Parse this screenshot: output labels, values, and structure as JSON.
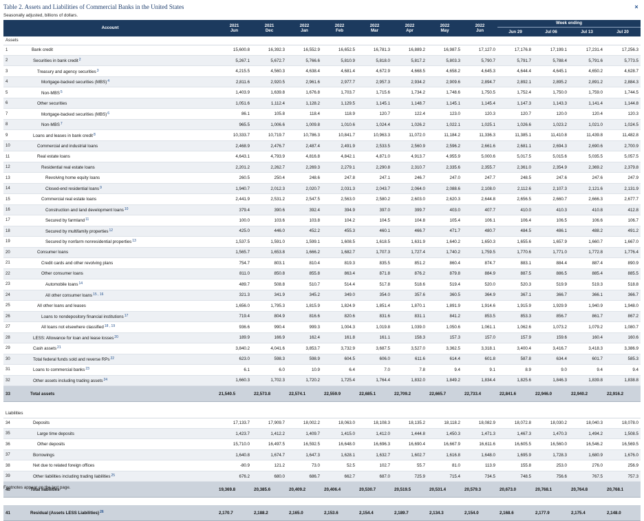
{
  "title": "Table 2. Assets and Liabilities of Commercial Banks in the United States",
  "subtitle": "Seasonally adjusted, billions of dollars.",
  "close_icon": "×",
  "footnote": "Footnotes appear on the last page.",
  "header": {
    "account": "Account",
    "week_ending": "Week ending",
    "columns": [
      {
        "top": "2021",
        "bottom": "Jun"
      },
      {
        "top": "2021",
        "bottom": "Dec"
      },
      {
        "top": "2022",
        "bottom": "Jan"
      },
      {
        "top": "2022",
        "bottom": "Feb"
      },
      {
        "top": "2022",
        "bottom": "Mar"
      },
      {
        "top": "2022",
        "bottom": "Apr"
      },
      {
        "top": "2022",
        "bottom": "May"
      },
      {
        "top": "2022",
        "bottom": "Jun"
      }
    ],
    "weeks": [
      "Jun 29",
      "Jul 06",
      "Jul 13",
      "Jul 20"
    ]
  },
  "sections": [
    {
      "label": "Assets",
      "rows": [
        {
          "n": "1",
          "label": "Bank credit",
          "indent": 0,
          "values": [
            "15,600.8",
            "16,392.3",
            "16,552.9",
            "16,652.5",
            "16,781.3",
            "16,889.2",
            "16,987.5",
            "17,127.0",
            "17,176.8",
            "17,199.1",
            "17,231.4",
            "17,256.3"
          ]
        },
        {
          "n": "2",
          "label": "Securities in bank credit",
          "fn": "2",
          "indent": 1,
          "values": [
            "5,267.1",
            "5,672.7",
            "5,766.6",
            "5,810.9",
            "5,818.0",
            "5,817.2",
            "5,803.3",
            "5,790.7",
            "5,791.7",
            "5,788.4",
            "5,791.6",
            "5,773.5"
          ]
        },
        {
          "n": "3",
          "label": "Treasury and agency securities",
          "fn": "3",
          "indent": 2,
          "values": [
            "4,215.5",
            "4,560.3",
            "4,638.4",
            "4,681.4",
            "4,672.9",
            "4,668.5",
            "4,658.2",
            "4,645.3",
            "4,644.4",
            "4,645.1",
            "4,650.2",
            "4,628.7"
          ]
        },
        {
          "n": "4",
          "label": "Mortgage-backed securities (MBS)",
          "fn": "4",
          "indent": 3,
          "values": [
            "2,811.6",
            "2,920.5",
            "2,961.6",
            "2,977.7",
            "2,957.3",
            "2,934.2",
            "2,909.6",
            "2,894.7",
            "2,892.1",
            "2,895.2",
            "2,891.2",
            "2,884.3"
          ]
        },
        {
          "n": "5",
          "label": "Non-MBS",
          "fn": "5",
          "indent": 3,
          "values": [
            "1,403.9",
            "1,639.8",
            "1,676.8",
            "1,703.7",
            "1,715.6",
            "1,734.2",
            "1,748.6",
            "1,750.5",
            "1,752.4",
            "1,750.0",
            "1,759.0",
            "1,744.5"
          ]
        },
        {
          "n": "6",
          "label": "Other securities",
          "indent": 2,
          "values": [
            "1,051.6",
            "1,112.4",
            "1,128.2",
            "1,129.5",
            "1,145.1",
            "1,148.7",
            "1,145.1",
            "1,145.4",
            "1,147.3",
            "1,143.3",
            "1,141.4",
            "1,144.8"
          ]
        },
        {
          "n": "7",
          "label": "Mortgage-backed securities (MBS)",
          "fn": "6",
          "indent": 3,
          "values": [
            "86.1",
            "105.8",
            "118.4",
            "118.9",
            "120.7",
            "122.4",
            "123.0",
            "120.3",
            "120.7",
            "120.0",
            "120.4",
            "120.3"
          ]
        },
        {
          "n": "8",
          "label": "Non-MBS",
          "fn": "7",
          "indent": 3,
          "values": [
            "965.5",
            "1,006.6",
            "1,009.8",
            "1,010.6",
            "1,024.4",
            "1,026.2",
            "1,022.1",
            "1,025.1",
            "1,026.6",
            "1,023.2",
            "1,021.0",
            "1,024.5"
          ]
        },
        {
          "n": "9",
          "label": "Loans and leases in bank credit",
          "fn": "8",
          "indent": 1,
          "values": [
            "10,333.7",
            "10,719.7",
            "10,786.3",
            "10,841.7",
            "10,963.3",
            "11,072.0",
            "11,184.2",
            "11,336.3",
            "11,385.1",
            "11,410.8",
            "11,439.8",
            "11,482.8"
          ]
        },
        {
          "n": "10",
          "label": "Commercial and industrial loans",
          "indent": 2,
          "values": [
            "2,468.9",
            "2,476.7",
            "2,487.4",
            "2,491.9",
            "2,533.5",
            "2,560.9",
            "2,596.2",
            "2,661.6",
            "2,681.1",
            "2,694.3",
            "2,690.6",
            "2,700.9"
          ]
        },
        {
          "n": "11",
          "label": "Real estate loans",
          "indent": 2,
          "values": [
            "4,643.1",
            "4,793.9",
            "4,816.8",
            "4,842.1",
            "4,871.0",
            "4,913.7",
            "4,955.9",
            "5,000.6",
            "5,017.5",
            "5,015.6",
            "5,035.5",
            "5,057.5"
          ]
        },
        {
          "n": "12",
          "label": "Residential real estate loans",
          "indent": 3,
          "values": [
            "2,201.2",
            "2,262.7",
            "2,269.3",
            "2,279.1",
            "2,290.8",
            "2,310.7",
            "2,335.6",
            "2,355.7",
            "2,361.0",
            "2,354.9",
            "2,369.2",
            "2,379.8"
          ]
        },
        {
          "n": "13",
          "label": "Revolving home equity loans",
          "indent": 4,
          "values": [
            "260.5",
            "250.4",
            "248.6",
            "247.8",
            "247.1",
            "246.7",
            "247.0",
            "247.7",
            "248.5",
            "247.6",
            "247.6",
            "247.9"
          ]
        },
        {
          "n": "14",
          "label": "Closed-end residential loans",
          "fn": "9",
          "indent": 4,
          "values": [
            "1,940.7",
            "2,012.3",
            "2,020.7",
            "2,031.3",
            "2,043.7",
            "2,064.0",
            "2,088.6",
            "2,108.0",
            "2,112.6",
            "2,107.3",
            "2,121.6",
            "2,131.9"
          ]
        },
        {
          "n": "15",
          "label": "Commercial real estate loans",
          "indent": 3,
          "values": [
            "2,441.9",
            "2,531.2",
            "2,547.5",
            "2,563.0",
            "2,580.2",
            "2,603.0",
            "2,620.3",
            "2,644.8",
            "2,656.5",
            "2,660.7",
            "2,666.3",
            "2,677.7"
          ]
        },
        {
          "n": "16",
          "label": "Construction and land development loans",
          "fn": "10",
          "indent": 4,
          "values": [
            "379.4",
            "390.6",
            "392.4",
            "394.9",
            "397.0",
            "399.7",
            "403.0",
            "407.7",
            "410.0",
            "410.3",
            "410.8",
            "412.8"
          ]
        },
        {
          "n": "17",
          "label": "Secured by farmland",
          "fn": "11",
          "indent": 4,
          "values": [
            "100.0",
            "103.6",
            "103.8",
            "104.2",
            "104.5",
            "104.8",
            "105.4",
            "106.1",
            "106.4",
            "106.5",
            "106.6",
            "106.7"
          ]
        },
        {
          "n": "18",
          "label": "Secured by multifamily properties",
          "fn": "12",
          "indent": 4,
          "values": [
            "425.0",
            "446.0",
            "452.2",
            "455.3",
            "460.1",
            "466.7",
            "471.7",
            "480.7",
            "484.5",
            "486.1",
            "488.2",
            "491.2"
          ]
        },
        {
          "n": "19",
          "label": "Secured by nonfarm nonresidential properties",
          "fn": "13",
          "indent": 4,
          "values": [
            "1,537.5",
            "1,591.0",
            "1,599.1",
            "1,608.5",
            "1,618.5",
            "1,631.9",
            "1,640.2",
            "1,650.3",
            "1,655.6",
            "1,657.9",
            "1,660.7",
            "1,667.0"
          ]
        },
        {
          "n": "20",
          "label": "Consumer loans",
          "indent": 2,
          "values": [
            "1,565.7",
            "1,653.8",
            "1,666.2",
            "1,682.7",
            "1,707.3",
            "1,727.4",
            "1,740.2",
            "1,759.5",
            "1,770.6",
            "1,771.0",
            "1,772.8",
            "1,776.4"
          ]
        },
        {
          "n": "21",
          "label": "Credit cards and other revolving plans",
          "indent": 3,
          "values": [
            "754.7",
            "803.1",
            "810.4",
            "819.3",
            "835.5",
            "851.2",
            "860.4",
            "874.7",
            "883.1",
            "884.4",
            "887.4",
            "890.9"
          ]
        },
        {
          "n": "22",
          "label": "Other consumer loans",
          "indent": 3,
          "values": [
            "811.0",
            "850.8",
            "855.8",
            "863.4",
            "871.8",
            "876.2",
            "879.8",
            "884.9",
            "887.5",
            "886.5",
            "885.4",
            "885.5"
          ]
        },
        {
          "n": "23",
          "label": "Automobile loans",
          "fn": "14",
          "indent": 4,
          "values": [
            "489.7",
            "508.8",
            "510.7",
            "514.4",
            "517.8",
            "518.6",
            "519.4",
            "520.0",
            "520.3",
            "519.9",
            "519.3",
            "518.8"
          ]
        },
        {
          "n": "24",
          "label": "All other consumer loans",
          "fn": "15 , 16",
          "indent": 4,
          "values": [
            "321.3",
            "341.9",
            "345.2",
            "349.0",
            "354.0",
            "357.6",
            "360.5",
            "364.9",
            "367.1",
            "366.7",
            "366.1",
            "366.7"
          ]
        },
        {
          "n": "25",
          "label": "All other loans and leases",
          "indent": 2,
          "values": [
            "1,656.0",
            "1,795.3",
            "1,815.9",
            "1,824.9",
            "1,851.4",
            "1,870.1",
            "1,891.9",
            "1,914.6",
            "1,915.9",
            "1,929.9",
            "1,940.9",
            "1,948.0"
          ]
        },
        {
          "n": "26",
          "label": "Loans to nondepository financial institutions",
          "fn": "17",
          "indent": 3,
          "values": [
            "719.4",
            "804.9",
            "816.6",
            "820.6",
            "831.6",
            "831.1",
            "841.2",
            "853.5",
            "853.3",
            "856.7",
            "861.7",
            "867.2"
          ]
        },
        {
          "n": "27",
          "label": "All loans not elsewhere classified",
          "fn": "18 , 19",
          "indent": 3,
          "values": [
            "936.6",
            "990.4",
            "999.3",
            "1,004.3",
            "1,019.8",
            "1,039.0",
            "1,050.6",
            "1,061.1",
            "1,062.6",
            "1,073.2",
            "1,079.2",
            "1,080.7"
          ]
        },
        {
          "n": "28",
          "label": "LESS: Allowance for loan and lease losses",
          "fn": "20",
          "indent": 1,
          "values": [
            "189.9",
            "166.9",
            "162.4",
            "161.8",
            "161.1",
            "158.3",
            "157.3",
            "157.0",
            "157.9",
            "159.6",
            "160.4",
            "160.6"
          ]
        },
        {
          "n": "29",
          "label": "Cash assets",
          "fn": "21",
          "indent": 1,
          "values": [
            "3,840.2",
            "4,041.6",
            "3,853.7",
            "3,732.9",
            "3,687.5",
            "3,527.0",
            "3,362.5",
            "3,318.1",
            "3,400.4",
            "3,416.7",
            "3,418.3",
            "3,386.9"
          ]
        },
        {
          "n": "30",
          "label": "Total federal funds sold and reverse RPs",
          "fn": "22",
          "indent": 1,
          "values": [
            "623.0",
            "598.3",
            "598.9",
            "604.5",
            "606.0",
            "611.6",
            "614.4",
            "601.8",
            "587.8",
            "634.4",
            "601.7",
            "585.3"
          ]
        },
        {
          "n": "31",
          "label": "Loans to commercial banks",
          "fn": "23",
          "indent": 1,
          "values": [
            "6.1",
            "6.0",
            "10.9",
            "6.4",
            "7.0",
            "7.8",
            "9.4",
            "9.1",
            "8.9",
            "9.0",
            "9.4",
            "9.4"
          ]
        },
        {
          "n": "32",
          "label": "Other assets including trading assets",
          "fn": "24",
          "indent": 1,
          "values": [
            "1,660.3",
            "1,702.3",
            "1,720.2",
            "1,725.4",
            "1,764.4",
            "1,832.0",
            "1,849.2",
            "1,834.4",
            "1,825.6",
            "1,846.3",
            "1,839.8",
            "1,838.8"
          ]
        }
      ],
      "total": {
        "n": "33",
        "label": "Total assets",
        "values": [
          "21,540.5",
          "22,573.8",
          "22,574.1",
          "22,559.9",
          "22,685.1",
          "22,709.2",
          "22,665.7",
          "22,733.4",
          "22,841.6",
          "22,946.0",
          "22,940.2",
          "22,916.2"
        ]
      }
    },
    {
      "label": "Liabilities",
      "rows": [
        {
          "n": "34",
          "label": "Deposits",
          "indent": 1,
          "values": [
            "17,133.7",
            "17,909.7",
            "18,002.2",
            "18,063.0",
            "18,108.3",
            "18,135.2",
            "18,118.2",
            "18,082.9",
            "18,072.8",
            "18,030.2",
            "18,040.3",
            "18,078.0"
          ]
        },
        {
          "n": "35",
          "label": "Large time deposits",
          "indent": 2,
          "values": [
            "1,423.7",
            "1,412.2",
            "1,409.7",
            "1,415.0",
            "1,412.0",
            "1,444.8",
            "1,450.3",
            "1,471.3",
            "1,467.3",
            "1,470.3",
            "1,494.2",
            "1,508.5"
          ]
        },
        {
          "n": "36",
          "label": "Other deposits",
          "indent": 2,
          "values": [
            "15,710.0",
            "16,497.5",
            "16,592.5",
            "16,648.0",
            "16,696.3",
            "16,690.4",
            "16,667.9",
            "16,611.6",
            "16,605.5",
            "16,560.0",
            "16,546.2",
            "16,569.5"
          ]
        },
        {
          "n": "37",
          "label": "Borrowings",
          "indent": 1,
          "values": [
            "1,640.8",
            "1,674.7",
            "1,647.3",
            "1,628.1",
            "1,632.7",
            "1,602.7",
            "1,616.8",
            "1,648.0",
            "1,695.9",
            "1,728.3",
            "1,680.9",
            "1,676.0"
          ]
        },
        {
          "n": "38",
          "label": "Net due to related foreign offices",
          "indent": 1,
          "values": [
            "-80.9",
            "121.2",
            "73.0",
            "52.5",
            "102.7",
            "55.7",
            "81.0",
            "113.9",
            "155.8",
            "253.0",
            "276.0",
            "256.9"
          ]
        },
        {
          "n": "39",
          "label": "Other liabilities including trading liabilities",
          "fn": "25",
          "indent": 1,
          "values": [
            "676.2",
            "680.0",
            "686.7",
            "662.7",
            "687.0",
            "725.9",
            "715.4",
            "734.5",
            "748.5",
            "756.6",
            "767.5",
            "757.3"
          ]
        }
      ],
      "total": {
        "n": "40",
        "label": "Total liabilities",
        "values": [
          "19,369.8",
          "20,385.6",
          "20,409.2",
          "20,406.4",
          "20,530.7",
          "20,519.5",
          "20,531.4",
          "20,579.3",
          "20,673.0",
          "20,768.1",
          "20,764.8",
          "20,768.1"
        ]
      }
    }
  ],
  "residual": {
    "n": "41",
    "label": "Residual (Assets LESS Liabilities)",
    "fn": "26",
    "values": [
      "2,170.7",
      "2,188.2",
      "2,165.0",
      "2,153.6",
      "2,154.4",
      "2,189.7",
      "2,134.3",
      "2,154.0",
      "2,168.6",
      "2,177.9",
      "2,175.4",
      "2,148.0"
    ]
  }
}
